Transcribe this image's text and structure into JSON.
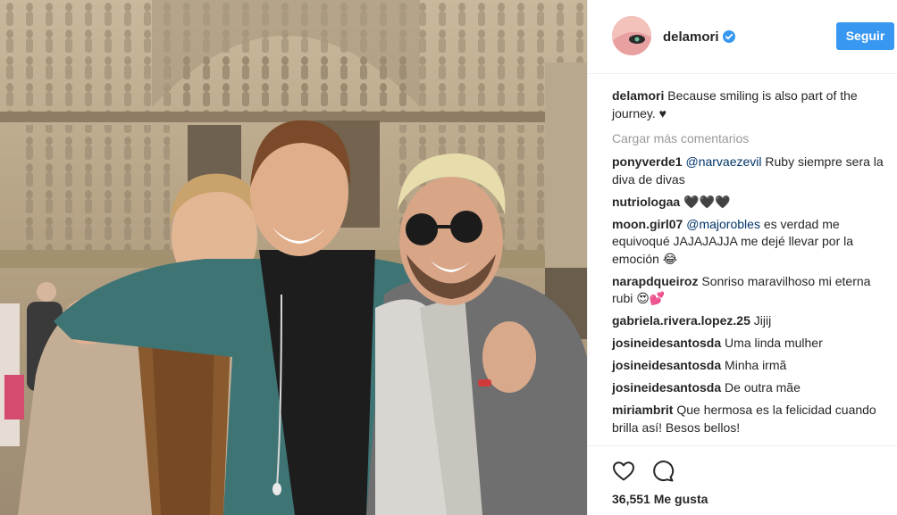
{
  "header": {
    "username": "delamori",
    "follow_label": "Seguir"
  },
  "caption": {
    "username": "delamori",
    "text": "Because smiling is also part of the journey. ♥"
  },
  "load_more_label": "Cargar más comentarios",
  "comments": [
    {
      "username": "ponyverde1",
      "mention": "@narvaezevil",
      "text": " Ruby siempre sera la diva de divas"
    },
    {
      "username": "nutriologaa",
      "mention": "",
      "text": "🖤🖤🖤"
    },
    {
      "username": "moon.girl07",
      "mention": "@majorobles",
      "text": " es verdad me equivoqué JAJAJAJJA me dejé llevar por la emoción 😂"
    },
    {
      "username": "narapdqueiroz",
      "mention": "",
      "text": "Sonriso maravilhoso mi eterna rubi 😍💕"
    },
    {
      "username": "gabriela.rivera.lopez.25",
      "mention": "",
      "text": "Jijij"
    },
    {
      "username": "josineidesantosda",
      "mention": "",
      "text": "Uma linda mulher"
    },
    {
      "username": "josineidesantosda",
      "mention": "",
      "text": "Minha irmã"
    },
    {
      "username": "josineidesantosda",
      "mention": "",
      "text": "De outra mãe"
    },
    {
      "username": "miriambrit",
      "mention": "",
      "text": "Que hermosa es la felicidad cuando brilla así! Besos bellos!"
    }
  ],
  "footer": {
    "likes_label": "36,551 Me gusta"
  },
  "icons": {
    "like": "heart-icon",
    "comment": "comment-icon",
    "verified": "verified-badge-icon"
  },
  "colors": {
    "accent": "#3897f0",
    "mention": "#003569",
    "muted": "#999999",
    "text": "#262626"
  }
}
